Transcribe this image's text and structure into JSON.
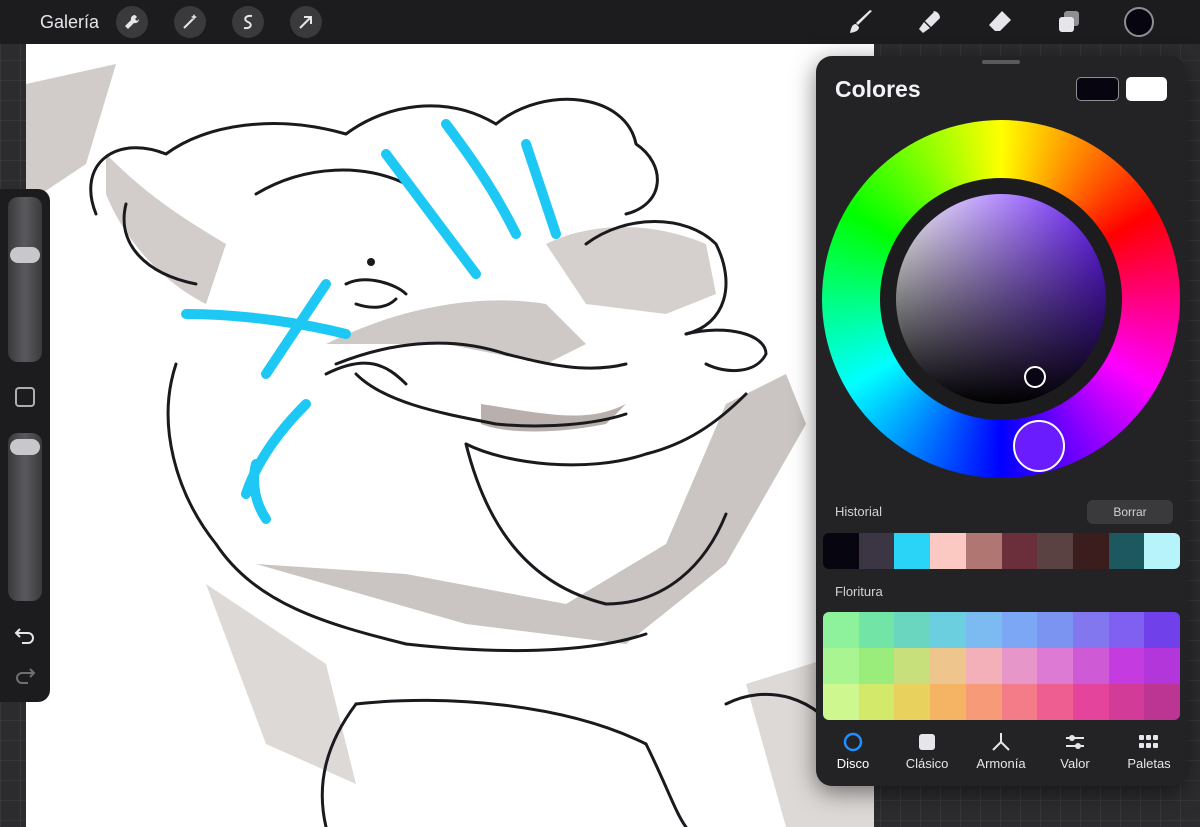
{
  "topbar": {
    "gallery_label": "Galería",
    "tools_left": [
      "wrench-icon",
      "magic-wand-icon",
      "selection-s-icon",
      "arrow-icon"
    ],
    "tools_right": [
      "brush-icon",
      "smudge-icon",
      "eraser-icon",
      "layers-icon"
    ],
    "current_color": "#07050f"
  },
  "panel": {
    "title": "Colores",
    "primary_color": "#07050f",
    "secondary_color": "#ffffff",
    "history_label": "Historial",
    "clear_label": "Borrar",
    "history_colors": [
      "#07050f",
      "#3c3644",
      "#2ad4f6",
      "#fcc9c2",
      "#b07671",
      "#6a2f3b",
      "#5a4242",
      "#3c1d1e",
      "#1d5760",
      "#b6f3fb"
    ],
    "palette_label": "Floritura",
    "palette_colors": [
      "#8ef29c",
      "#72e5a6",
      "#6ad6c0",
      "#6ccfe0",
      "#7cbaf2",
      "#7ba7f4",
      "#7b94f2",
      "#8277ef",
      "#8060f0",
      "#7040ea",
      "#a8f592",
      "#9aed7a",
      "#c8e07c",
      "#eec58c",
      "#f4b0b9",
      "#e696c8",
      "#dc7ad4",
      "#cf5ad6",
      "#c43ce0",
      "#b236d9",
      "#cff78f",
      "#d3e969",
      "#e8d25d",
      "#f5b463",
      "#f69a77",
      "#f37c88",
      "#ee5e90",
      "#e4449b",
      "#d23c98",
      "#bc3592"
    ],
    "tabs": [
      {
        "label": "Disco",
        "icon": "disc-icon",
        "active": true
      },
      {
        "label": "Clásico",
        "icon": "classic-square-icon",
        "active": false
      },
      {
        "label": "Armonía",
        "icon": "harmony-icon",
        "active": false
      },
      {
        "label": "Valor",
        "icon": "sliders-icon",
        "active": false
      },
      {
        "label": "Paletas",
        "icon": "palettes-grid-icon",
        "active": false
      }
    ]
  }
}
